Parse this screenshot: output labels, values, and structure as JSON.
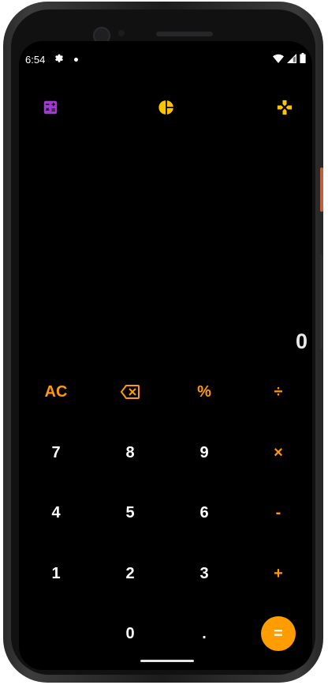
{
  "status": {
    "time": "6:54",
    "icons": [
      "gear-icon",
      "notification-dot-icon",
      "wifi-icon",
      "signal-icon",
      "battery-icon"
    ]
  },
  "toolbar": {
    "icons": [
      "calculator-icon",
      "pie-chart-icon",
      "gamepad-icon"
    ],
    "colors": {
      "calculator": "#9b3ec9",
      "pie": "#ffc400",
      "gamepad": "#ffc400"
    }
  },
  "display": {
    "value": "0"
  },
  "keys": {
    "row1": [
      "AC",
      "backspace",
      "%",
      "÷"
    ],
    "row2": [
      "7",
      "8",
      "9",
      "×"
    ],
    "row3": [
      "4",
      "5",
      "6",
      "-"
    ],
    "row4": [
      "1",
      "2",
      "3",
      "+"
    ],
    "row5": [
      "0",
      ".",
      "="
    ]
  },
  "colors": {
    "accent": "#ff9a00",
    "background": "#000000",
    "digits": "#ffffff"
  }
}
